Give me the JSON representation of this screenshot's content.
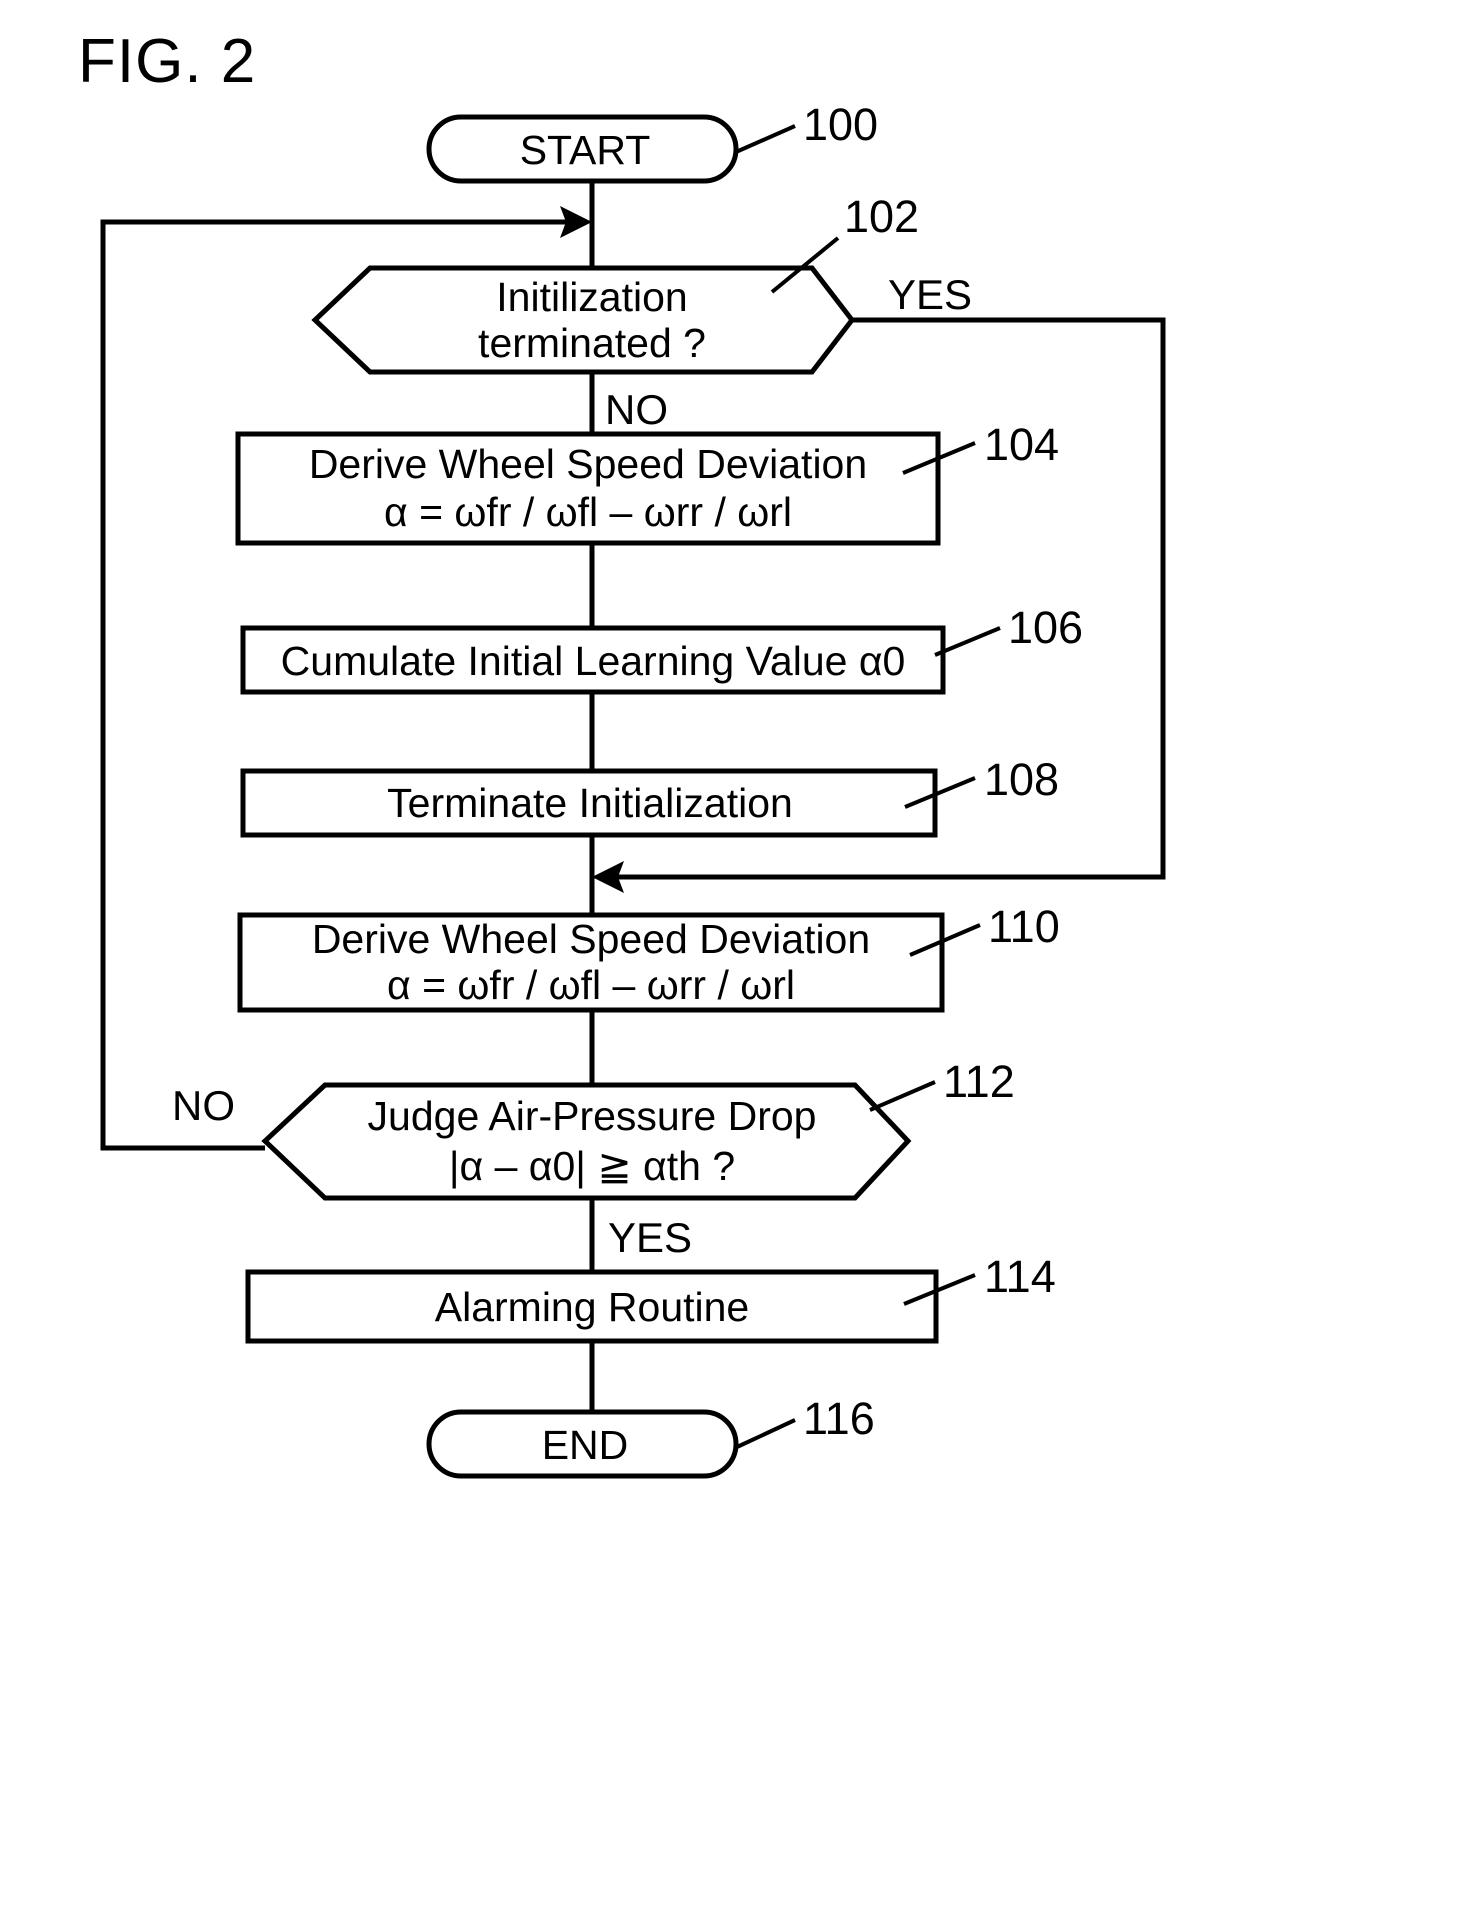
{
  "figure": {
    "title": "FIG. 2"
  },
  "diagram": {
    "type": "flowchart",
    "nodes": [
      {
        "id": "start",
        "ref": "100",
        "shape": "terminator",
        "lines": [
          "START"
        ]
      },
      {
        "id": "init-check",
        "ref": "102",
        "shape": "decision-hexagon",
        "lines": [
          "Initilization",
          "terminated ?"
        ]
      },
      {
        "id": "derive-deviation-init",
        "ref": "104",
        "shape": "process",
        "lines": [
          "Derive Wheel Speed Deviation",
          "α = ωfr / ωfl – ωrr / ωrl"
        ]
      },
      {
        "id": "cumulate-initial-learning",
        "ref": "106",
        "shape": "process",
        "lines": [
          "Cumulate Initial Learning Value α0"
        ]
      },
      {
        "id": "terminate-initialization",
        "ref": "108",
        "shape": "process",
        "lines": [
          "Terminate Initialization"
        ]
      },
      {
        "id": "derive-deviation-main",
        "ref": "110",
        "shape": "process",
        "lines": [
          "Derive Wheel Speed Deviation",
          "α = ωfr / ωfl – ωrr / ωrl"
        ]
      },
      {
        "id": "judge-air-pressure",
        "ref": "112",
        "shape": "decision-hexagon",
        "lines": [
          "Judge Air-Pressure Drop",
          "|α – α0| ≧ αth ?"
        ]
      },
      {
        "id": "alarming-routine",
        "ref": "114",
        "shape": "process",
        "lines": [
          "Alarming Routine"
        ]
      },
      {
        "id": "end",
        "ref": "116",
        "shape": "terminator",
        "lines": [
          "END"
        ]
      }
    ],
    "branch_labels": {
      "init_yes": "YES",
      "init_no": "NO",
      "judge_no": "NO",
      "judge_yes": "YES"
    }
  }
}
